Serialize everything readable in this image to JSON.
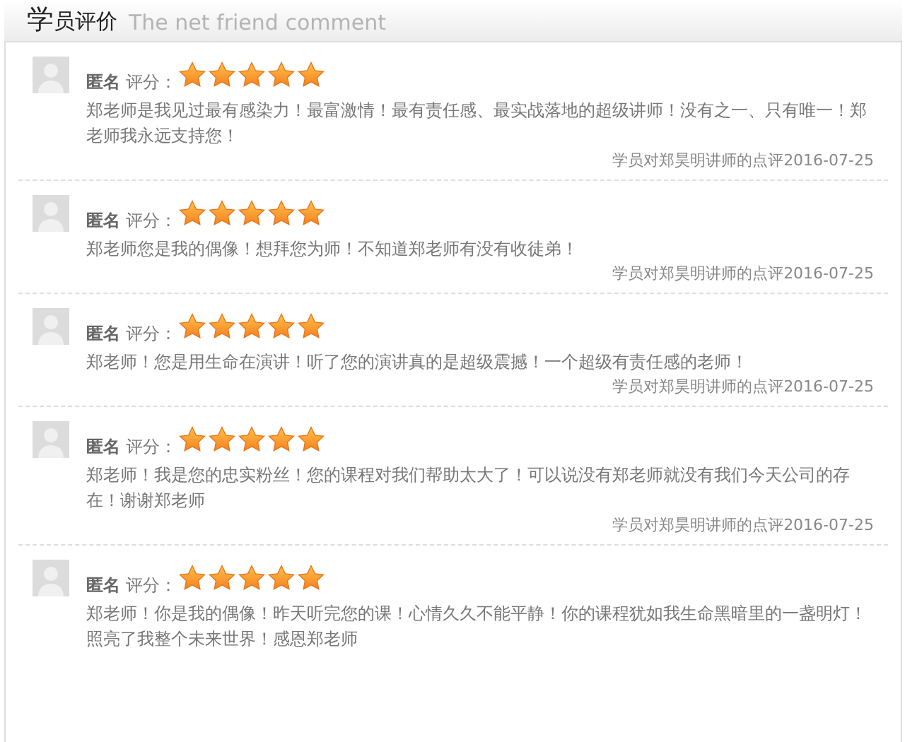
{
  "header": {
    "title_lead": "学",
    "title": "员评价",
    "subtitle": "The net friend comment"
  },
  "reviews": [
    {
      "name": "匿名",
      "rating_label": "评分：",
      "stars": 5,
      "text": "郑老师是我见过最有感染力！最富激情！最有责任感、最实战落地的超级讲师！没有之一、只有唯一！郑老师我永远支持您！",
      "footer": "学员对郑昊明讲师的点评2016-07-25"
    },
    {
      "name": "匿名",
      "rating_label": "评分：",
      "stars": 5,
      "text": "郑老师您是我的偶像！想拜您为师！不知道郑老师有没有收徒弟！",
      "footer": "学员对郑昊明讲师的点评2016-07-25"
    },
    {
      "name": "匿名",
      "rating_label": "评分：",
      "stars": 5,
      "text": "郑老师！您是用生命在演讲！听了您的演讲真的是超级震撼！一个超级有责任感的老师！",
      "footer": "学员对郑昊明讲师的点评2016-07-25"
    },
    {
      "name": "匿名",
      "rating_label": "评分：",
      "stars": 5,
      "text": "郑老师！我是您的忠实粉丝！您的课程对我们帮助太大了！可以说没有郑老师就没有我们今天公司的存在！谢谢郑老师",
      "footer": "学员对郑昊明讲师的点评2016-07-25"
    },
    {
      "name": "匿名",
      "rating_label": "评分：",
      "stars": 5,
      "text": "郑老师！你是我的偶像！昨天听完您的课！心情久久不能平静！你的课程犹如我生命黑暗里的一盏明灯！照亮了我整个未来世界！感恩郑老师"
    }
  ]
}
